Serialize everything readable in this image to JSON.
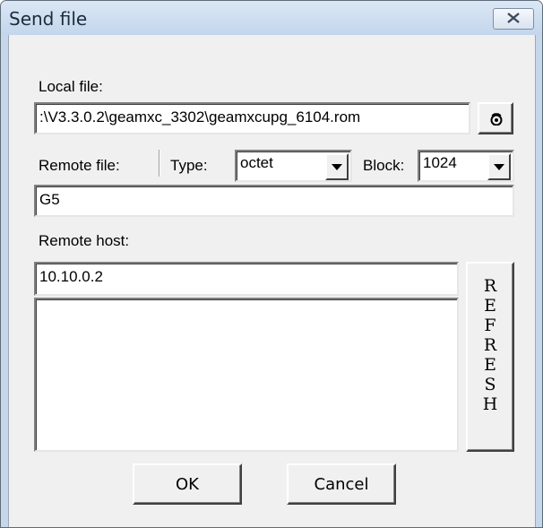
{
  "window": {
    "title": "Send file"
  },
  "local_file": {
    "label": "Local file:",
    "value": ":\\V3.3.0.2\\geamxc_3302\\geamxcupg_6104.rom"
  },
  "remote_file": {
    "label": "Remote file:",
    "value": "G5"
  },
  "type": {
    "label": "Type:",
    "selected": "octet"
  },
  "block": {
    "label": "Block:",
    "selected": "1024"
  },
  "remote_host": {
    "label": "Remote host:",
    "value": "10.10.0.2",
    "list_items": []
  },
  "refresh": {
    "letters": [
      "R",
      "E",
      "F",
      "R",
      "E",
      "S",
      "H"
    ]
  },
  "buttons": {
    "ok": "OK",
    "cancel": "Cancel"
  },
  "icons": {
    "browse": "browse-icon",
    "close": "close-icon"
  }
}
